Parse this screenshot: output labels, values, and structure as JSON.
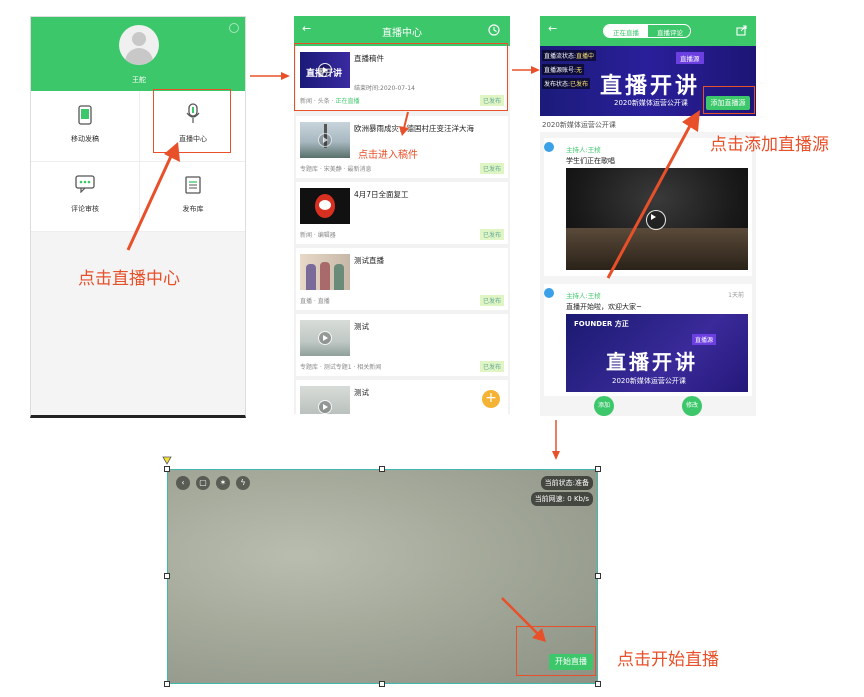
{
  "screen1": {
    "user_name": "王舵",
    "menu": [
      {
        "label": "移动发稿",
        "icon": "phone-icon"
      },
      {
        "label": "直播中心",
        "icon": "microphone-icon"
      },
      {
        "label": "评论审核",
        "icon": "comment-icon"
      },
      {
        "label": "发布库",
        "icon": "list-icon"
      }
    ]
  },
  "screen2": {
    "title": "直播中心",
    "items": [
      {
        "title": "直播稿件",
        "sub": "结束时间:2020-07-14",
        "meta": "新闻 · 头条 ·",
        "meta_live": "正在直播",
        "badge": "已发布",
        "thumb_text": "直播开讲"
      },
      {
        "title": "欧洲暴雨成灾，德国村庄变汪洋大海",
        "meta": "专题库 · 宋美静 · 最新消息",
        "badge": "已发布"
      },
      {
        "title": "4月7日全面复工",
        "meta": "新闻 · 编辑器",
        "badge": "已发布"
      },
      {
        "title": "测试直播",
        "meta": "直播 · 直播",
        "badge": "已发布"
      },
      {
        "title": "测试",
        "meta": "专题库 · 测试专题1 · 相关新闻",
        "badge": "已发布"
      },
      {
        "title": "测试",
        "meta": "",
        "badge": ""
      }
    ]
  },
  "screen3": {
    "tab_active": "正在直播",
    "tab_other": "直播评论",
    "banner_big": "直播开讲",
    "banner_small": "2020新媒体运营公开课",
    "banner_tag": "直播源",
    "status": [
      {
        "label": "直播流状态:",
        "value": "直播中"
      },
      {
        "label": "直播源账号:",
        "value": "无"
      },
      {
        "label": "发布状态:",
        "value": "已发布"
      }
    ],
    "add_source_label": "添加直播源",
    "caption": "2020新媒体运营公开课",
    "messages": [
      {
        "host": "主持人:王桢",
        "text": "学生们正在歌唱",
        "time": ""
      },
      {
        "host": "主持人:王桢",
        "text": "直播开始啦，欢迎大家~",
        "time": "1天前"
      }
    ],
    "founder_logo": "FOUNDER 方正",
    "card_tag": "直播源",
    "card_big": "直播开讲",
    "card_small": "2020新媒体运营公开课",
    "btn_add": "添加",
    "btn_edit": "修改"
  },
  "screen4": {
    "status": "当前状态:准备",
    "speed": "当前网速: 0 Kb/s",
    "start_label": "开始直播"
  },
  "annotations": {
    "a1": "点击直播中心",
    "a2": "点击进入稿件",
    "a3": "点击添加直播源",
    "a4": "点击开始直播"
  },
  "colors": {
    "accent": "#3cc76a",
    "annotation": "#e8502a"
  }
}
